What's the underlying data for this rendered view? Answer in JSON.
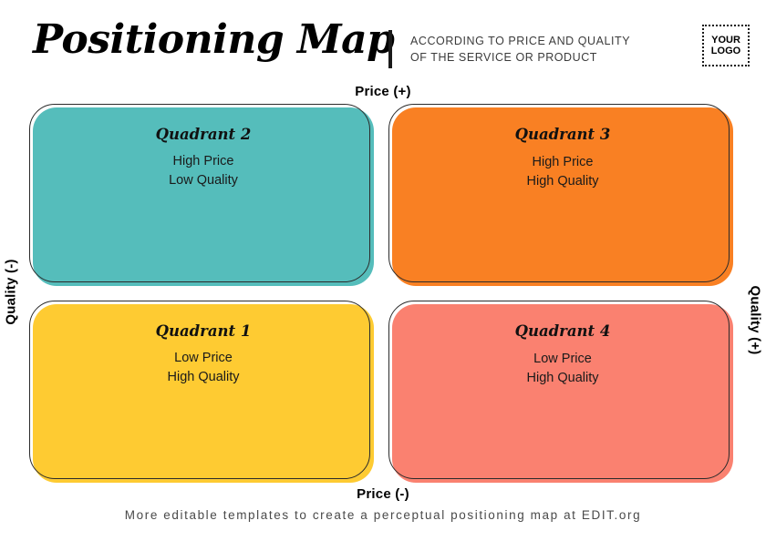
{
  "header": {
    "title": "Positioning Map",
    "subtitle_line1": "ACCORDING TO PRICE AND QUALITY",
    "subtitle_line2": "OF THE SERVICE OR PRODUCT",
    "logo_line1": "YOUR",
    "logo_line2": "LOGO"
  },
  "axes": {
    "top": "Price (+)",
    "bottom": "Price (-)",
    "left": "Quality (-)",
    "right": "Quality (+)"
  },
  "quadrants": [
    {
      "id": "quadrant-2",
      "title": "Quadrant 2",
      "line1": "High Price",
      "line2": "Low Quality",
      "color": "#55bdbb",
      "position": "top-left"
    },
    {
      "id": "quadrant-3",
      "title": "Quadrant 3",
      "line1": "High Price",
      "line2": "High Quality",
      "color": "#f98023",
      "position": "top-right"
    },
    {
      "id": "quadrant-1",
      "title": "Quadrant 1",
      "line1": "Low Price",
      "line2": "High Quality",
      "color": "#fecb32",
      "position": "bottom-left"
    },
    {
      "id": "quadrant-4",
      "title": "Quadrant 4",
      "line1": "Low Price",
      "line2": "High Quality",
      "color": "#fa8170",
      "position": "bottom-right"
    }
  ],
  "footer": {
    "text": "More editable templates to create a perceptual positioning map at EDIT.org"
  },
  "colors": {
    "teal": "#55bdbb",
    "orange": "#f98023",
    "yellow": "#fecb32",
    "salmon": "#fa8170",
    "outline": "#2b2b2b",
    "text": "#000000",
    "background": "#ffffff"
  }
}
